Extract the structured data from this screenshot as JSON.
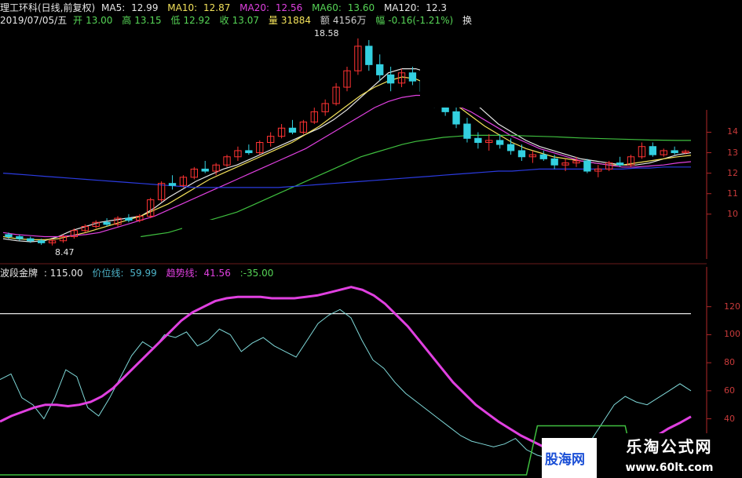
{
  "header": {
    "name": "理工环科(日线,前复权)",
    "ma5_label": "MA5:",
    "ma5_value": "12.99",
    "ma10_label": "MA10:",
    "ma10_value": "12.87",
    "ma20_label": "MA20:",
    "ma20_value": "12.56",
    "ma60_label": "MA60:",
    "ma60_value": "13.60",
    "ma120_label": "MA120:",
    "ma120_value": "12.3",
    "date": "2019/07/05/五",
    "open_label": "开",
    "open_value": "13.00",
    "high_label": "高",
    "high_value": "13.15",
    "low_label": "低",
    "low_value": "12.92",
    "close_label": "收",
    "close_value": "13.07",
    "vol_label": "量",
    "vol_value": "31884",
    "amt_label": "额",
    "amt_value": "4156万",
    "chg_label": "幅",
    "chg_value": "-0.16(-1.21%)",
    "extra": "换"
  },
  "price_annotations": {
    "high": "18.58",
    "low": "8.47"
  },
  "indicator_header": {
    "name": "波段金牌",
    "value": ": 115.00",
    "line1_label": "价位线:",
    "line1_value": "59.99",
    "line2_label": "趋势线:",
    "line2_value": "41.56",
    "line3_value": ":-35.00"
  },
  "price_axis_ticks": [
    "14",
    "13",
    "12",
    "11",
    "10"
  ],
  "indicator_axis_ticks": [
    "120",
    "100",
    "80",
    "60",
    "40",
    "20"
  ],
  "brand": {
    "name": "乐淘公式网",
    "url": "www.60lt.com",
    "partner": "股海网"
  },
  "colors": {
    "ma5": "#e6e6e6",
    "ma10": "#f2e15a",
    "ma20": "#e040e0",
    "ma60": "#3fbf3f",
    "ma120": "#2b3be0",
    "up": "#ff3333",
    "down": "#33d0e0",
    "price_line": "#7fd8d8",
    "trend_line": "#e040e0"
  },
  "chart_data": [
    {
      "type": "candlestick",
      "ylim": [
        8,
        19
      ],
      "high_marker": 18.58,
      "low_marker": 8.47,
      "candles": [
        [
          9.0,
          9.1,
          8.8,
          8.9
        ],
        [
          8.9,
          9.0,
          8.7,
          8.8
        ],
        [
          8.8,
          8.9,
          8.6,
          8.7
        ],
        [
          8.7,
          8.8,
          8.5,
          8.6
        ],
        [
          8.6,
          8.8,
          8.47,
          8.7
        ],
        [
          8.7,
          9.0,
          8.6,
          8.9
        ],
        [
          8.9,
          9.3,
          8.8,
          9.2
        ],
        [
          9.2,
          9.5,
          9.1,
          9.4
        ],
        [
          9.4,
          9.7,
          9.3,
          9.6
        ],
        [
          9.6,
          9.8,
          9.4,
          9.5
        ],
        [
          9.5,
          9.9,
          9.4,
          9.8
        ],
        [
          9.8,
          10.0,
          9.6,
          9.7
        ],
        [
          9.7,
          10.0,
          9.6,
          9.9
        ],
        [
          9.9,
          10.8,
          9.8,
          10.7
        ],
        [
          10.7,
          11.6,
          10.6,
          11.5
        ],
        [
          11.5,
          11.9,
          11.2,
          11.4
        ],
        [
          11.4,
          11.9,
          11.3,
          11.8
        ],
        [
          11.8,
          12.3,
          11.7,
          12.2
        ],
        [
          12.2,
          12.6,
          12.0,
          12.1
        ],
        [
          12.1,
          12.5,
          11.9,
          12.4
        ],
        [
          12.4,
          12.9,
          12.3,
          12.8
        ],
        [
          12.8,
          13.3,
          12.6,
          13.1
        ],
        [
          13.1,
          13.4,
          12.9,
          13.0
        ],
        [
          13.0,
          13.6,
          12.9,
          13.5
        ],
        [
          13.5,
          14.0,
          13.3,
          13.8
        ],
        [
          13.8,
          14.4,
          13.7,
          14.2
        ],
        [
          14.2,
          14.6,
          13.9,
          14.0
        ],
        [
          14.0,
          14.6,
          13.9,
          14.5
        ],
        [
          14.5,
          15.2,
          14.4,
          15.0
        ],
        [
          15.0,
          15.6,
          14.8,
          15.4
        ],
        [
          15.4,
          16.4,
          15.3,
          16.2
        ],
        [
          16.2,
          17.2,
          16.0,
          17.0
        ],
        [
          17.0,
          18.58,
          16.8,
          18.2
        ],
        [
          18.2,
          18.5,
          17.0,
          17.3
        ],
        [
          17.3,
          17.8,
          16.5,
          16.8
        ],
        [
          16.8,
          17.2,
          16.0,
          16.4
        ],
        [
          16.4,
          17.1,
          16.2,
          16.9
        ],
        [
          16.9,
          17.2,
          16.3,
          16.5
        ],
        [
          16.5,
          16.9,
          15.8,
          16.0
        ],
        [
          16.0,
          16.3,
          15.2,
          15.5
        ],
        [
          15.5,
          15.9,
          14.8,
          15.0
        ],
        [
          15.0,
          15.3,
          14.2,
          14.4
        ],
        [
          14.4,
          14.7,
          13.5,
          13.7
        ],
        [
          13.7,
          14.0,
          13.2,
          13.5
        ],
        [
          13.5,
          13.9,
          13.1,
          13.6
        ],
        [
          13.6,
          13.9,
          13.2,
          13.4
        ],
        [
          13.4,
          13.7,
          12.9,
          13.1
        ],
        [
          13.1,
          13.4,
          12.6,
          12.8
        ],
        [
          12.8,
          13.1,
          12.5,
          12.9
        ],
        [
          12.9,
          13.1,
          12.6,
          12.7
        ],
        [
          12.7,
          12.9,
          12.2,
          12.4
        ],
        [
          12.4,
          12.7,
          12.1,
          12.5
        ],
        [
          12.5,
          12.8,
          12.3,
          12.6
        ],
        [
          12.6,
          12.7,
          12.0,
          12.1
        ],
        [
          12.1,
          12.4,
          11.8,
          12.2
        ],
        [
          12.2,
          12.6,
          12.1,
          12.5
        ],
        [
          12.5,
          12.8,
          12.3,
          12.4
        ],
        [
          12.4,
          12.9,
          12.3,
          12.8
        ],
        [
          12.8,
          13.5,
          12.7,
          13.3
        ],
        [
          13.3,
          13.5,
          12.8,
          12.9
        ],
        [
          12.9,
          13.2,
          12.8,
          13.1
        ],
        [
          13.1,
          13.3,
          12.9,
          13.0
        ],
        [
          13.0,
          13.15,
          12.92,
          13.07
        ]
      ],
      "ma": {
        "MA5": [
          8.8,
          8.7,
          8.65,
          8.7,
          8.9,
          9.2,
          9.4,
          9.6,
          9.7,
          9.8,
          9.9,
          10.3,
          10.8,
          11.2,
          11.6,
          11.9,
          12.2,
          12.4,
          12.7,
          13.0,
          13.3,
          13.6,
          13.9,
          14.2,
          14.6,
          15.1,
          15.7,
          16.3,
          16.9,
          17.1,
          17.1,
          16.9,
          16.6,
          16.2,
          15.6,
          15.0,
          14.4,
          14.0,
          13.6,
          13.3,
          13.1,
          12.9,
          12.7,
          12.6,
          12.5,
          12.4,
          12.4,
          12.5,
          12.7,
          12.9,
          13.0
        ],
        "MA10": [
          8.9,
          8.8,
          8.75,
          8.75,
          8.8,
          8.95,
          9.1,
          9.3,
          9.5,
          9.7,
          9.9,
          10.2,
          10.5,
          10.9,
          11.3,
          11.7,
          12.0,
          12.3,
          12.6,
          12.9,
          13.2,
          13.5,
          13.9,
          14.3,
          14.8,
          15.3,
          15.8,
          16.2,
          16.5,
          16.7,
          16.6,
          16.3,
          15.8,
          15.3,
          14.8,
          14.3,
          13.9,
          13.5,
          13.2,
          13.0,
          12.8,
          12.7,
          12.6,
          12.5,
          12.4,
          12.4,
          12.5,
          12.6,
          12.7,
          12.8,
          12.87
        ],
        "MA20": [
          9.1,
          9.0,
          8.95,
          8.9,
          8.9,
          8.95,
          9.0,
          9.1,
          9.3,
          9.5,
          9.7,
          9.9,
          10.2,
          10.5,
          10.8,
          11.1,
          11.4,
          11.7,
          12.0,
          12.3,
          12.6,
          12.9,
          13.2,
          13.6,
          14.0,
          14.4,
          14.8,
          15.2,
          15.5,
          15.7,
          15.8,
          15.8,
          15.6,
          15.3,
          15.0,
          14.6,
          14.2,
          13.8,
          13.5,
          13.2,
          13.0,
          12.8,
          12.6,
          12.5,
          12.4,
          12.3,
          12.3,
          12.35,
          12.4,
          12.5,
          12.56
        ],
        "MA60": [
          null,
          null,
          null,
          null,
          null,
          null,
          null,
          null,
          null,
          null,
          8.9,
          9.0,
          9.1,
          9.3,
          9.5,
          9.7,
          9.9,
          10.1,
          10.4,
          10.7,
          11.0,
          11.3,
          11.6,
          11.9,
          12.2,
          12.5,
          12.8,
          13.0,
          13.2,
          13.4,
          13.55,
          13.65,
          13.75,
          13.8,
          13.85,
          13.85,
          13.85,
          13.85,
          13.82,
          13.8,
          13.78,
          13.75,
          13.72,
          13.7,
          13.68,
          13.66,
          13.64,
          13.62,
          13.61,
          13.6,
          13.6
        ],
        "MA120": [
          12.0,
          11.95,
          11.9,
          11.85,
          11.8,
          11.75,
          11.7,
          11.65,
          11.6,
          11.55,
          11.5,
          11.45,
          11.4,
          11.35,
          11.3,
          11.3,
          11.3,
          11.3,
          11.3,
          11.3,
          11.3,
          11.35,
          11.4,
          11.45,
          11.5,
          11.55,
          11.6,
          11.65,
          11.7,
          11.75,
          11.8,
          11.85,
          11.9,
          11.95,
          12.0,
          12.05,
          12.1,
          12.1,
          12.15,
          12.2,
          12.2,
          12.2,
          12.2,
          12.2,
          12.2,
          12.2,
          12.25,
          12.25,
          12.3,
          12.3,
          12.3
        ]
      }
    },
    {
      "type": "line",
      "ylim": [
        0,
        140
      ],
      "series": [
        {
          "name": "波段金牌",
          "values": [
            115,
            115,
            115,
            115,
            115,
            115,
            115,
            115,
            115,
            115,
            115,
            115,
            115,
            115,
            115,
            115,
            115,
            115,
            115,
            115,
            115,
            115,
            115,
            115,
            115,
            115,
            115,
            115,
            115,
            115,
            115,
            115,
            115,
            115,
            115,
            115,
            115,
            115,
            115,
            115,
            115,
            115,
            115,
            115,
            115,
            115,
            115,
            115,
            115,
            115,
            115,
            115,
            115,
            115,
            115,
            115,
            115,
            115,
            115,
            115
          ]
        },
        {
          "name": "价位线",
          "values": [
            68,
            72,
            55,
            50,
            40,
            55,
            75,
            70,
            48,
            42,
            55,
            70,
            85,
            95,
            90,
            100,
            98,
            102,
            92,
            96,
            104,
            100,
            88,
            94,
            98,
            92,
            88,
            84,
            96,
            108,
            114,
            118,
            112,
            96,
            82,
            76,
            66,
            58,
            52,
            46,
            40,
            34,
            28,
            24,
            22,
            20,
            22,
            26,
            18,
            14,
            12,
            10,
            14,
            20,
            26,
            38,
            50,
            56,
            52,
            50,
            55,
            60,
            65,
            59.99
          ]
        },
        {
          "name": "趋势线",
          "values": [
            38,
            42,
            45,
            48,
            50,
            50,
            49,
            50,
            52,
            56,
            62,
            70,
            78,
            86,
            94,
            102,
            110,
            116,
            120,
            124,
            126,
            127,
            127,
            127,
            126,
            126,
            126,
            127,
            128,
            130,
            132,
            134,
            132,
            128,
            122,
            114,
            106,
            96,
            86,
            76,
            66,
            58,
            50,
            44,
            38,
            33,
            28,
            24,
            20,
            18,
            16,
            15,
            14,
            14,
            15,
            17,
            20,
            24,
            28,
            33,
            37,
            41.56
          ]
        },
        {
          "name": "底部区",
          "values": [
            0,
            0,
            0,
            0,
            0,
            0,
            0,
            0,
            0,
            0,
            0,
            0,
            0,
            0,
            0,
            0,
            0,
            0,
            0,
            0,
            0,
            0,
            0,
            0,
            0,
            0,
            0,
            0,
            0,
            0,
            0,
            0,
            0,
            0,
            0,
            0,
            0,
            0,
            0,
            0,
            0,
            0,
            0,
            0,
            0,
            0,
            0,
            0,
            0,
            35,
            35,
            35,
            35,
            35,
            35,
            35,
            35,
            35,
            0,
            0,
            0,
            0,
            0,
            0
          ]
        }
      ]
    }
  ]
}
